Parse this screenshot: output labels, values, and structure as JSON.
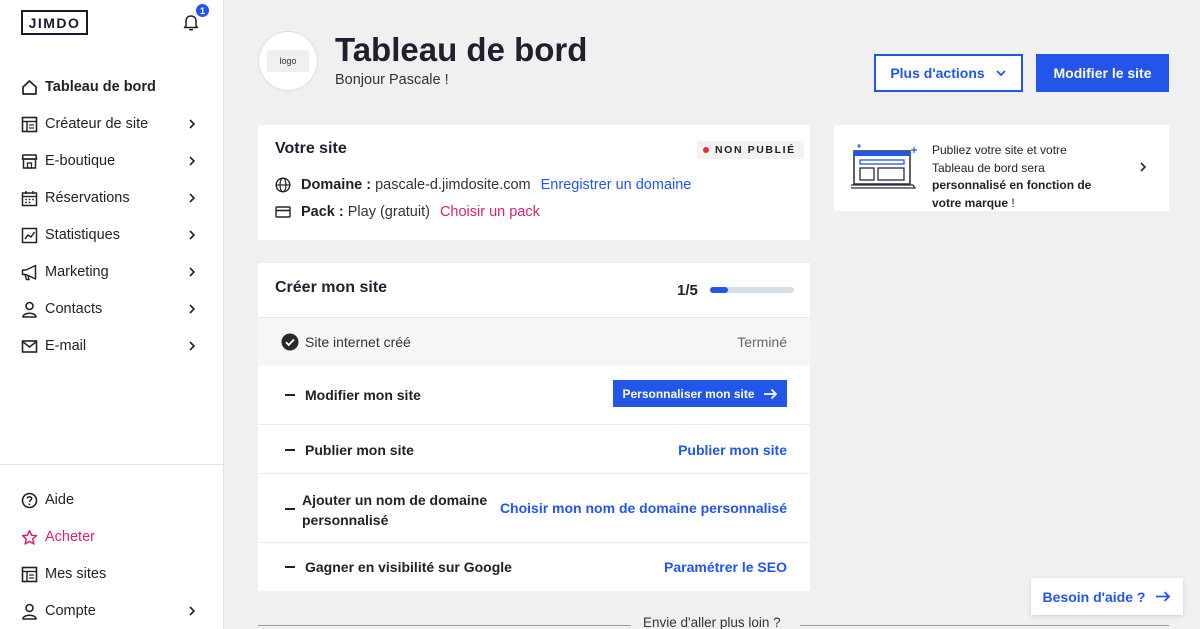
{
  "sidebar": {
    "brand": "JIMDO",
    "notification_count": "1",
    "items": [
      {
        "label": "Tableau de bord"
      },
      {
        "label": "Créateur de site"
      },
      {
        "label": "E-boutique"
      },
      {
        "label": "Réservations"
      },
      {
        "label": "Statistiques"
      },
      {
        "label": "Marketing"
      },
      {
        "label": "Contacts"
      },
      {
        "label": "E-mail"
      }
    ],
    "bottom_items": [
      {
        "label": "Aide"
      },
      {
        "label": "Acheter"
      },
      {
        "label": "Mes sites"
      },
      {
        "label": "Compte"
      }
    ]
  },
  "header": {
    "logo_placeholder": "logo",
    "title": "Tableau de bord",
    "greeting": "Bonjour Pascale !",
    "more_actions_label": "Plus d'actions",
    "edit_site_label": "Modifier le site"
  },
  "site_card": {
    "title": "Votre site",
    "status": "NON PUBLIÉ",
    "domain_label": "Domaine :",
    "domain_value": "pascale-d.jimdosite.com",
    "domain_link": "Enregistrer un domaine",
    "pack_label": "Pack :",
    "pack_value": "Play (gratuit)",
    "pack_link": "Choisir un pack"
  },
  "promo": {
    "text_start": "Publiez votre site et votre Tableau de bord sera ",
    "text_bold": "personnalisé en fonction de votre marque",
    "text_end": " !"
  },
  "create_card": {
    "title": "Créer mon site",
    "progress_text": "1/5",
    "progress_fraction": 0.2,
    "done_step": {
      "label": "Site internet créé",
      "status": "Terminé"
    },
    "steps": [
      {
        "label": "Modifier mon site",
        "action": "Personnaliser mon site"
      },
      {
        "label": "Publier mon site",
        "action": "Publier mon site"
      },
      {
        "label_line1": "Ajouter un nom de domaine",
        "label_line2": "personnalisé",
        "action": "Choisir mon nom de domaine personnalisé"
      },
      {
        "label": "Gagner en visibilité sur Google",
        "action": "Paramétrer le SEO"
      }
    ]
  },
  "footer": {
    "more_text": "Envie d'aller plus loin ?",
    "help_label": "Besoin d'aide ?"
  },
  "colors": {
    "primary": "#2255e8",
    "accent_pink": "#d6246e",
    "status_red": "#e02f3f",
    "background": "#f0f0f0"
  }
}
